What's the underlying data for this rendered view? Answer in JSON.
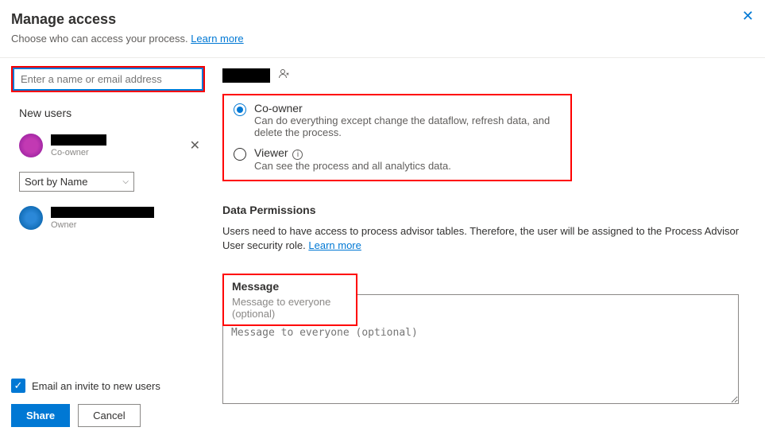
{
  "header": {
    "title": "Manage access",
    "subtitle": "Choose who can access your process.",
    "learn_more": "Learn more"
  },
  "search": {
    "placeholder": "Enter a name or email address"
  },
  "sidebar": {
    "new_users_heading": "New users",
    "sort_label": "Sort by Name",
    "users": [
      {
        "role": "Co-owner"
      },
      {
        "role": "Owner"
      }
    ]
  },
  "roles": {
    "coowner": {
      "label": "Co-owner",
      "desc": "Can do everything except change the dataflow, refresh data, and delete the process."
    },
    "viewer": {
      "label": "Viewer",
      "desc": "Can see the process and all analytics data."
    }
  },
  "permissions": {
    "title": "Data Permissions",
    "text": "Users need to have access to process advisor tables. Therefore, the user will be assigned to the Process Advisor User security role.",
    "learn_more": "Learn more"
  },
  "message": {
    "title": "Message",
    "placeholder": "Message to everyone (optional)"
  },
  "footer": {
    "email_invite": "Email an invite to new users",
    "share": "Share",
    "cancel": "Cancel"
  }
}
